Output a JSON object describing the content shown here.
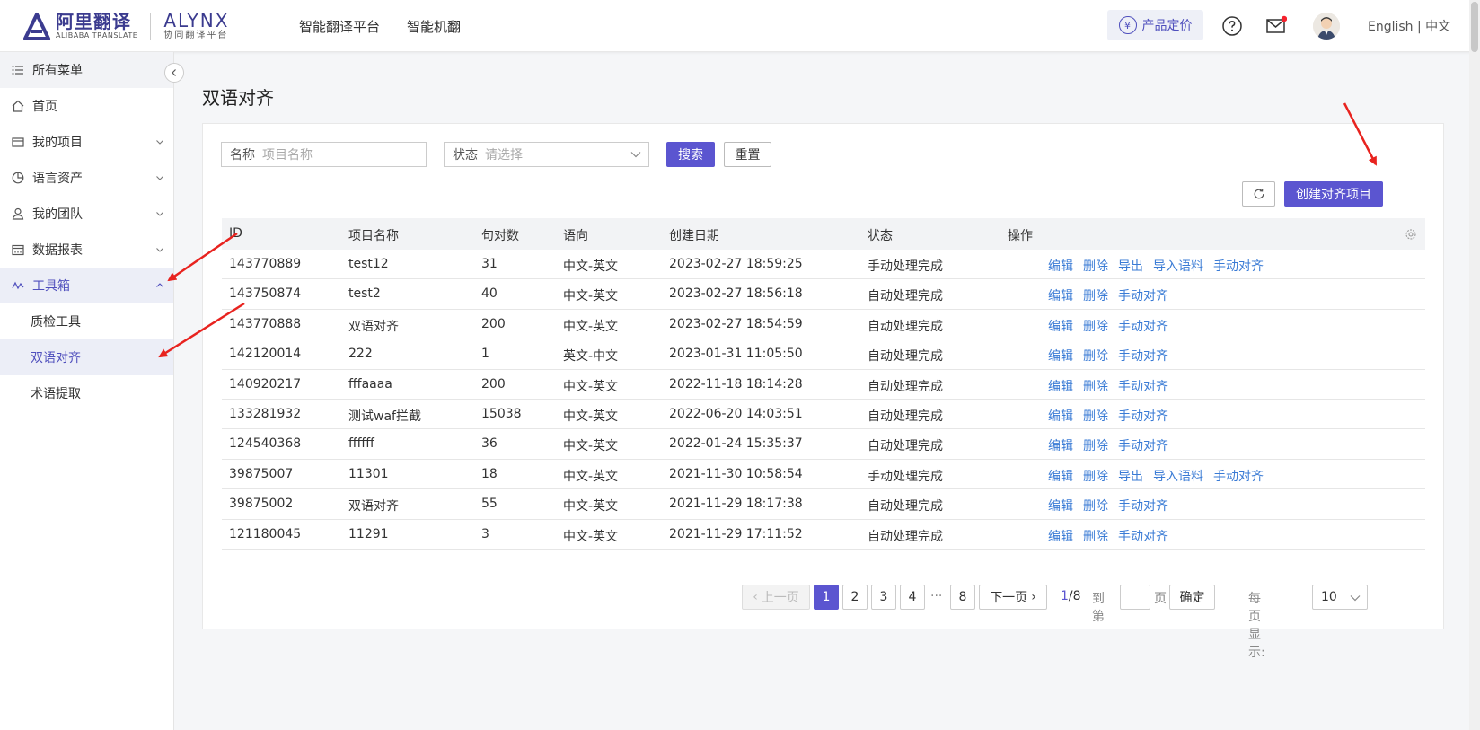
{
  "header": {
    "logo_cn": "阿里翻译",
    "logo_en": "ALIBABA TRANSLATE",
    "logo_alynx": "ALYNX",
    "logo_alynx_sub": "协同翻译平台",
    "nav": [
      "智能翻译平台",
      "智能机翻"
    ],
    "pricing_label": "产品定价",
    "lang_switch": "English | 中文",
    "icons": [
      "yen-icon",
      "help-icon",
      "mail-icon",
      "avatar"
    ],
    "notification_dot_color": "#f5222d"
  },
  "sidebar": {
    "all_menu": "所有菜单",
    "items": [
      {
        "label": "首页",
        "icon": "home-icon"
      },
      {
        "label": "我的项目",
        "icon": "folder-icon"
      },
      {
        "label": "语言资产",
        "icon": "pie-chart-icon"
      },
      {
        "label": "我的团队",
        "icon": "user-icon"
      },
      {
        "label": "数据报表",
        "icon": "calendar-icon"
      },
      {
        "label": "工具箱",
        "icon": "toolbox-icon"
      }
    ],
    "sub_items": [
      "质检工具",
      "双语对齐",
      "术语提取"
    ],
    "active_sub": "双语对齐"
  },
  "main": {
    "title": "双语对齐",
    "filter": {
      "name_label": "名称",
      "name_placeholder": "项目名称",
      "status_label": "状态",
      "status_placeholder": "请选择",
      "search_label": "搜索",
      "reset_label": "重置"
    },
    "create_label": "创建对齐项目",
    "accent_color": "#5b55d0",
    "link_color": "#3a7bd5"
  },
  "table": {
    "headers": [
      "ID",
      "项目名称",
      "句对数",
      "语向",
      "创建日期",
      "状态",
      "操作"
    ],
    "rows": [
      {
        "id": "143770889",
        "name": "test12",
        "pairs": "31",
        "direction": "中文-英文",
        "date": "2023-02-27 18:59:25",
        "status": "手动处理完成",
        "ops": [
          "编辑",
          "删除",
          "导出",
          "导入语料",
          "手动对齐"
        ]
      },
      {
        "id": "143750874",
        "name": "test2",
        "pairs": "40",
        "direction": "中文-英文",
        "date": "2023-02-27 18:56:18",
        "status": "自动处理完成",
        "ops": [
          "编辑",
          "删除",
          "手动对齐"
        ]
      },
      {
        "id": "143770888",
        "name": "双语对齐",
        "pairs": "200",
        "direction": "中文-英文",
        "date": "2023-02-27 18:54:59",
        "status": "自动处理完成",
        "ops": [
          "编辑",
          "删除",
          "手动对齐"
        ]
      },
      {
        "id": "142120014",
        "name": "222",
        "pairs": "1",
        "direction": "英文-中文",
        "date": "2023-01-31 11:05:50",
        "status": "自动处理完成",
        "ops": [
          "编辑",
          "删除",
          "手动对齐"
        ]
      },
      {
        "id": "140920217",
        "name": "fffaaaa",
        "pairs": "200",
        "direction": "中文-英文",
        "date": "2022-11-18 18:14:28",
        "status": "自动处理完成",
        "ops": [
          "编辑",
          "删除",
          "手动对齐"
        ]
      },
      {
        "id": "133281932",
        "name": "测试waf拦截",
        "pairs": "15038",
        "direction": "中文-英文",
        "date": "2022-06-20 14:03:51",
        "status": "自动处理完成",
        "ops": [
          "编辑",
          "删除",
          "手动对齐"
        ]
      },
      {
        "id": "124540368",
        "name": "ffffff",
        "pairs": "36",
        "direction": "中文-英文",
        "date": "2022-01-24 15:35:37",
        "status": "自动处理完成",
        "ops": [
          "编辑",
          "删除",
          "手动对齐"
        ]
      },
      {
        "id": "39875007",
        "name": "11301",
        "pairs": "18",
        "direction": "中文-英文",
        "date": "2021-11-30 10:58:54",
        "status": "手动处理完成",
        "ops": [
          "编辑",
          "删除",
          "导出",
          "导入语料",
          "手动对齐"
        ]
      },
      {
        "id": "39875002",
        "name": "双语对齐",
        "pairs": "55",
        "direction": "中文-英文",
        "date": "2021-11-29 18:17:38",
        "status": "自动处理完成",
        "ops": [
          "编辑",
          "删除",
          "手动对齐"
        ]
      },
      {
        "id": "121180045",
        "name": "11291",
        "pairs": "3",
        "direction": "中文-英文",
        "date": "2021-11-29 17:11:52",
        "status": "自动处理完成",
        "ops": [
          "编辑",
          "删除",
          "手动对齐"
        ]
      }
    ]
  },
  "pagination": {
    "prev_label": "上一页",
    "pages": [
      "1",
      "2",
      "3",
      "4",
      "8"
    ],
    "ellipsis": "···",
    "current_page": "1",
    "next_label": "下一页",
    "page_info_current": "1",
    "page_info_total": "/8",
    "goto_label": "到第",
    "page_unit": "页",
    "confirm_label": "确定",
    "per_page_label": "每页显示:",
    "per_page_value": "10"
  },
  "annotation_arrow_color": "#e8231f"
}
